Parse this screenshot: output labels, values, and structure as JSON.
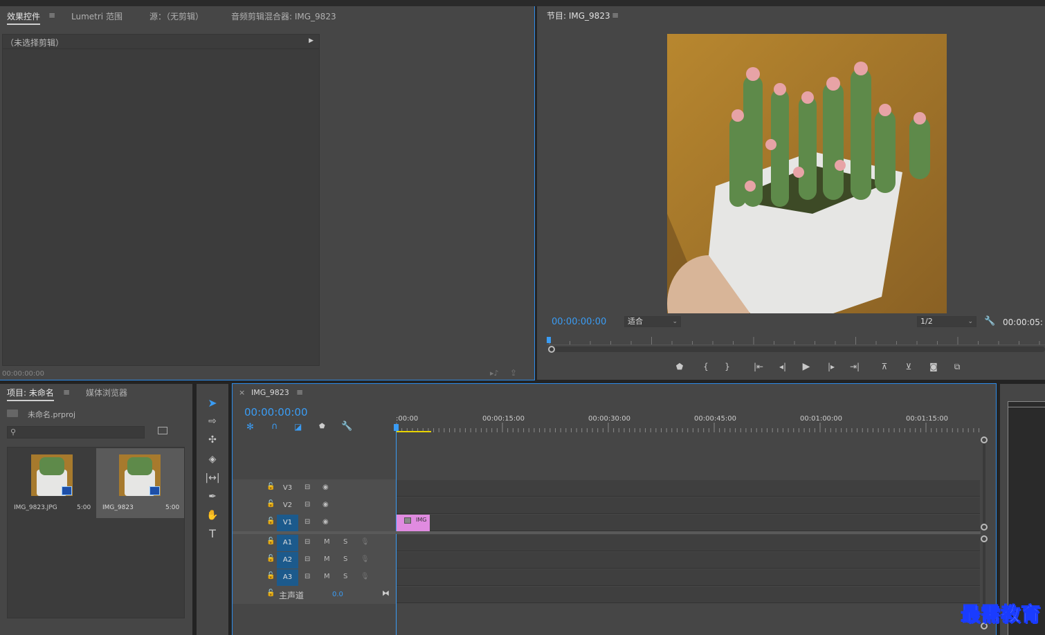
{
  "effects_panel": {
    "tabs": [
      "效果控件",
      "Lumetri 范围",
      "源：（无剪辑）",
      "音频剪辑混合器: IMG_9823"
    ],
    "menu_glyph": "≡",
    "no_clip_label": "（未选择剪辑）",
    "timecode": "00:00:00:00"
  },
  "program_monitor": {
    "tab": "节目: IMG_9823",
    "menu_glyph": "≡",
    "current_timecode": "00:00:00:00",
    "fit_select": "适合",
    "resolution_select": "1/2",
    "duration_timecode": "00:00:05:",
    "playhead_position": 0.0
  },
  "project_panel": {
    "tabs": [
      "项目: 未命名",
      "媒体浏览器"
    ],
    "menu_glyph": "≡",
    "project_file": "未命名.prproj",
    "search_placeholder": "",
    "items": [
      {
        "name": "IMG_9823.JPG",
        "duration": "5:00",
        "selected": false
      },
      {
        "name": "IMG_9823",
        "duration": "5:00",
        "selected": true
      }
    ]
  },
  "timeline": {
    "close_glyph": "×",
    "sequence_name": "IMG_9823",
    "menu_glyph": "≡",
    "timecode": "00:00:00:00",
    "ruler_labels": [
      ":00:00",
      "00:00:15:00",
      "00:00:30:00",
      "00:00:45:00",
      "00:01:00:00",
      "00:01:15:00"
    ],
    "video_tracks": [
      {
        "name": "V3",
        "active": false
      },
      {
        "name": "V2",
        "active": false
      },
      {
        "name": "V1",
        "active": true
      }
    ],
    "audio_tracks": [
      {
        "name": "A1",
        "active": true
      },
      {
        "name": "A2",
        "active": true
      },
      {
        "name": "A3",
        "active": true
      }
    ],
    "audio_m_label": "M",
    "audio_s_label": "S",
    "master_label": "主声道",
    "master_value": "0.0",
    "clip_label": "IMG",
    "clip_color": "#e08be0"
  },
  "colors": {
    "accent_blue": "#3a9cf4",
    "panel_bg": "#464646",
    "selection_outline": "#2d8ceb",
    "clip_pink": "#e08be0"
  },
  "watermark": "最需教育"
}
